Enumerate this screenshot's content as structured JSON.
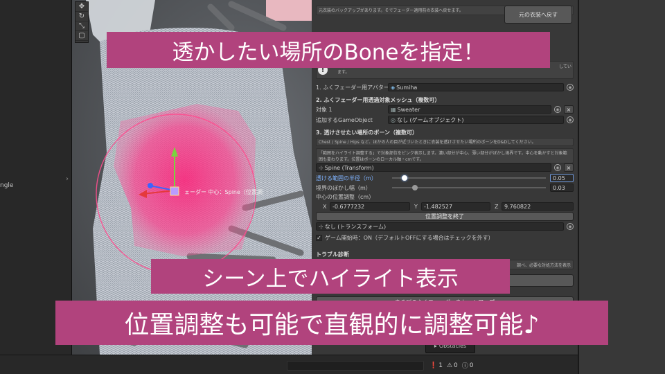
{
  "overlay": {
    "top": "透かしたい場所のBoneを指定！",
    "middle": "シーン上でハイライト表示",
    "bottom": "位置調整も可能で直観的に調整可能♪"
  },
  "hierarchy": {
    "partial_item": "ngle"
  },
  "scene": {
    "gizmo_label": "ェーダー 中心：Spine（",
    "gizmo_label_suffix": "位置調"
  },
  "inspector": {
    "backup_note": "元衣装のバックアップがあります。そでフェーダー適用前の衣装へ戻せます。",
    "restore_button": "元の衣装へ戻す",
    "info_partial": "ます。",
    "info_right_partial": "してい",
    "avatar": {
      "label": "1. ふくフェーダー用アバター",
      "value": "Sumiha"
    },
    "section2": {
      "title": "2. ふくフェーダー用透過対象メッシュ（複数可）",
      "target_label": "対象 1",
      "target_value": "Sweater",
      "add_label": "追加するGameObject",
      "add_value": "なし (ゲームオブジェクト)"
    },
    "section3": {
      "title": "3. 透けさせたい場所のボーン（複数可）",
      "hint": "Chest / Spine / Hips など、ほかの人の目が近づいたときに衣装を透けさせたい場所のボーンをD&Dしてください。",
      "range_desc": "「範囲をハイライト調整する」で対象部位をピンク表示します。濃い部分が中心、薄い部分がぼかし境界です。中心を動かすと対象範囲も変わります。位置はボーンのローカル軸・cmです。",
      "bone_value": "Spine (Transform)",
      "radius_label": "透ける範囲の半径（m）",
      "radius_value": "0.05",
      "radius_fraction": 0.08,
      "blur_label": "境界のぼかし幅（m）",
      "blur_value": "0.03",
      "blur_fraction": 0.15,
      "center_label": "中心の位置調整（cm）",
      "x_label": "X",
      "x_value": "-0.6777232",
      "y_label": "Y",
      "y_value": "-1.482527",
      "z_label": "Z",
      "z_value": "9.760822",
      "finish_button": "位置調整を終了",
      "transform_value": "なし (トランスフォーム)"
    },
    "game_start": {
      "checked": true,
      "label": "ゲーム開始時：ON（デフォルトOFFにする場合はチェックを外す）"
    },
    "trouble": {
      "title": "トラブル診断",
      "partial_right": "調べ、必要な対処方法を表示"
    },
    "setup_button": "あるびのふくフェーダーをセットアップ",
    "obstacles": "Obstacles"
  },
  "status": {
    "error_count": "1",
    "warning_count": "0",
    "info_count": "0"
  },
  "colors": {
    "banner": "#b1437d",
    "highlight": "#ff2f7a",
    "editor_bg": "#383838"
  }
}
